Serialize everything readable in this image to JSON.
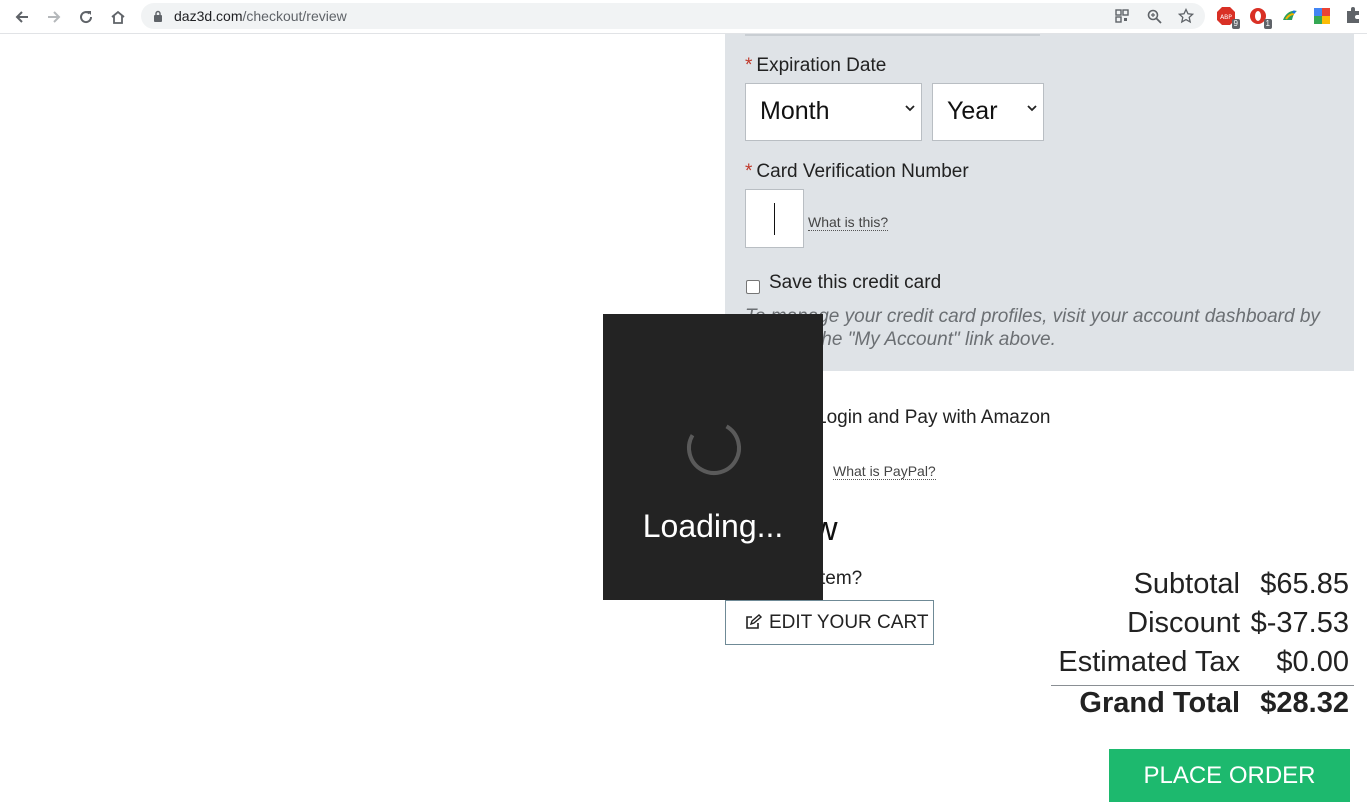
{
  "browser": {
    "url_domain": "daz3d.com",
    "url_path": "/checkout/review",
    "ext_badges": [
      "9",
      "1"
    ]
  },
  "payment": {
    "expiration_label": "Expiration Date",
    "month_value": "Month",
    "year_value": "Year",
    "cvv_label": "Card Verification Number",
    "cvv_help": "What is this?",
    "save_card_label": "Save this credit card",
    "manage_note_line1": "To manage your credit card profiles, visit your account dashboard by",
    "manage_note_line2": "the \"My Account\" link above."
  },
  "amazon_label": "Login and Pay with Amazon",
  "paypal_help": "What is PayPal?",
  "review": {
    "heading_fragment": "w",
    "question_fragment": "tem?",
    "edit_cart": "EDIT YOUR CART"
  },
  "totals": {
    "subtotal_label": "Subtotal",
    "subtotal_value": "$65.85",
    "discount_label": "Discount",
    "discount_value": "$-37.53",
    "tax_label": "Estimated Tax",
    "tax_value": "$0.00",
    "grand_label": "Grand Total",
    "grand_value": "$28.32"
  },
  "place_order": "PLACE ORDER",
  "loading_text": "Loading...",
  "colors": {
    "panel_bg": "#dfe3e7",
    "required": "#c0392b",
    "place_order_bg": "#1db96e",
    "overlay_bg": "#232323"
  }
}
